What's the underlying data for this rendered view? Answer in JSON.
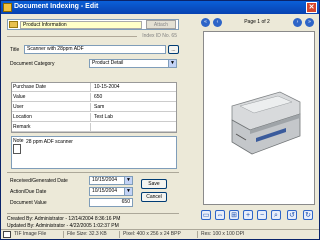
{
  "window": {
    "title": "Document Indexing - Edit",
    "close_glyph": "✕"
  },
  "header": {
    "doctype": "Product Information",
    "attach_label": "Attach",
    "index_id": "Index ID No. 65"
  },
  "form": {
    "title_label": "Title",
    "title_value": "Scanner with 28ppm ADF",
    "title_button": "...",
    "category_label": "Document Category",
    "category_value": "Product Detail",
    "rows": [
      {
        "key": "Purchase Date",
        "value": "10-15-2004"
      },
      {
        "key": "Value",
        "value": "650"
      },
      {
        "key": "User",
        "value": "Sam"
      },
      {
        "key": "Location",
        "value": "Test Lab"
      },
      {
        "key": "Remark",
        "value": ""
      }
    ],
    "note_label": "Note",
    "note_value": "28 ppm ADF scanner"
  },
  "dates": {
    "received_label": "Received/Generated Date",
    "received_value": "10/15/2004",
    "action_label": "Action/Due Date",
    "action_value": "10/15/2004",
    "docvalue_label": "Document Value",
    "docvalue_value": "650",
    "save_label": "Save",
    "cancel_label": "Cancel"
  },
  "footer": {
    "created_by": "Created By:     Administrator - 12/14/2004 8:36:16 PM",
    "updated_by": "Updated By:     Administrator - 4/22/2005 1:02:37 PM"
  },
  "viewer": {
    "page_info": "Page 1 of 2",
    "nav": [
      "«",
      "‹",
      "›",
      "»"
    ]
  },
  "status": {
    "file_type": "TIF Image File",
    "file_size": "File Size: 32.3 KB",
    "pixel": "Pixel: 400 x 256 x 24 BPP",
    "res": "Res: 100 x 100 DPI"
  },
  "colors": {
    "titlebar": "#0a5fd8",
    "field_border": "#7f9db9",
    "doctype_bg": "#ffffc8"
  }
}
